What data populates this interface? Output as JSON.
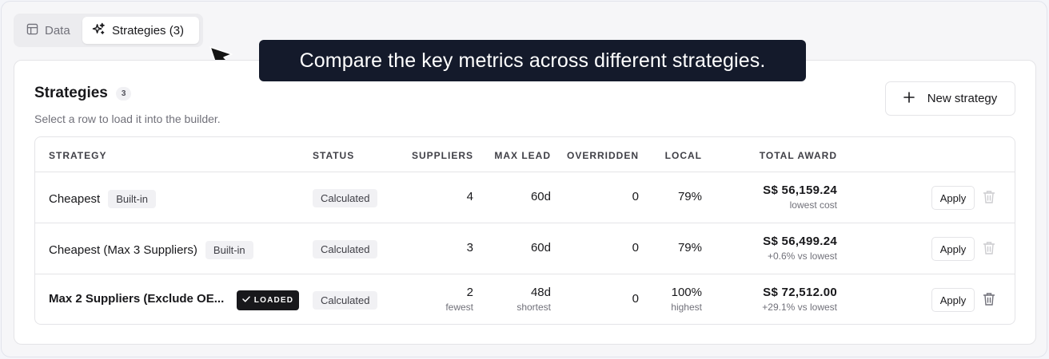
{
  "tabs": [
    {
      "label": "Data",
      "icon": "table-icon",
      "active": false
    },
    {
      "label": "Strategies (3)",
      "icon": "sparkle-icon",
      "active": true
    }
  ],
  "tooltip": {
    "text": "Compare the key metrics across different strategies."
  },
  "card": {
    "title": "Strategies",
    "count": "3",
    "subtitle": "Select a row to load it into the builder.",
    "new_button": "New strategy"
  },
  "table": {
    "headers": {
      "strategy": "STRATEGY",
      "status": "STATUS",
      "suppliers": "SUPPLIERS",
      "max_lead": "MAX LEAD",
      "overridden": "OVERRIDDEN",
      "local": "LOCAL",
      "total_award": "TOTAL AWARD"
    },
    "rows": [
      {
        "name": "Cheapest",
        "tag": "Built-in",
        "status": "Calculated",
        "suppliers": "4",
        "suppliers_note": "",
        "max_lead": "60d",
        "max_lead_note": "",
        "overridden": "0",
        "local": "79%",
        "local_note": "",
        "award": "S$ 56,159.24",
        "award_note": "lowest cost",
        "apply": "Apply"
      },
      {
        "name": "Cheapest (Max 3 Suppliers)",
        "tag": "Built-in",
        "status": "Calculated",
        "suppliers": "3",
        "suppliers_note": "",
        "max_lead": "60d",
        "max_lead_note": "",
        "overridden": "0",
        "local": "79%",
        "local_note": "",
        "award": "S$ 56,499.24",
        "award_note": "+0.6% vs lowest",
        "apply": "Apply"
      },
      {
        "name": "Max 2 Suppliers (Exclude OE...",
        "loaded": "LOADED",
        "status": "Calculated",
        "suppliers": "2",
        "suppliers_note": "fewest",
        "max_lead": "48d",
        "max_lead_note": "shortest",
        "overridden": "0",
        "local": "100%",
        "local_note": "highest",
        "award": "S$ 72,512.00",
        "award_note": "+29.1% vs lowest",
        "apply": "Apply"
      }
    ]
  },
  "colors": {
    "tooltip_bg": "#141a2b",
    "loaded_bg": "#18181b",
    "tab_bar": "#ececef"
  }
}
